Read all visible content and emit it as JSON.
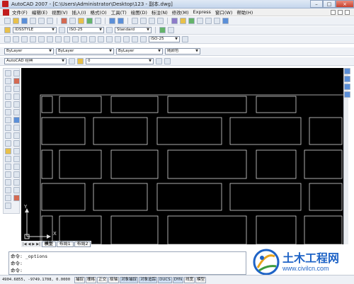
{
  "window": {
    "title": "AutoCAD 2007 - [C:\\Users\\Administrator\\Desktop\\123 - 副本.dwg]",
    "minimize": "–",
    "restore": "□",
    "close": "×"
  },
  "menus": [
    "文件(F)",
    "编辑(E)",
    "视图(V)",
    "插入(I)",
    "格式(O)",
    "工具(T)",
    "绘图(D)",
    "标注(N)",
    "修改(M)",
    "Express",
    "窗口(W)",
    "帮助(H)"
  ],
  "styles": {
    "text_style": "IDSSTYLE",
    "dim_style": "ISO-25",
    "table_style": "Standard",
    "dim_style_2": "ISO-25"
  },
  "layer": {
    "current": "ByLayer",
    "linetype": "ByLayer",
    "lineweight": "ByLayer",
    "color": "随颜色"
  },
  "workspace": "AutoCAD 经典",
  "layer_name": "0",
  "tabs": [
    "模型",
    "布局1",
    "布局2"
  ],
  "axis": {
    "x": "X",
    "y": "Y"
  },
  "command_lines": [
    "命令: _options",
    "命令:",
    "命令:"
  ],
  "status": {
    "coords": "4904.6855, -9749.1708, 0.0000",
    "buttons": [
      "捕捉",
      "栅格",
      "正交",
      "极轴",
      "对象捕捉",
      "对象追踪",
      "DUCS",
      "DYN",
      "线宽",
      "模型"
    ]
  },
  "logo": {
    "title": "土木工程网",
    "url": "www.civilcn.com"
  },
  "colors": {
    "canvas": "#000000",
    "brick_line": "#d8d8d8",
    "logo_blue": "#1e63c6"
  }
}
